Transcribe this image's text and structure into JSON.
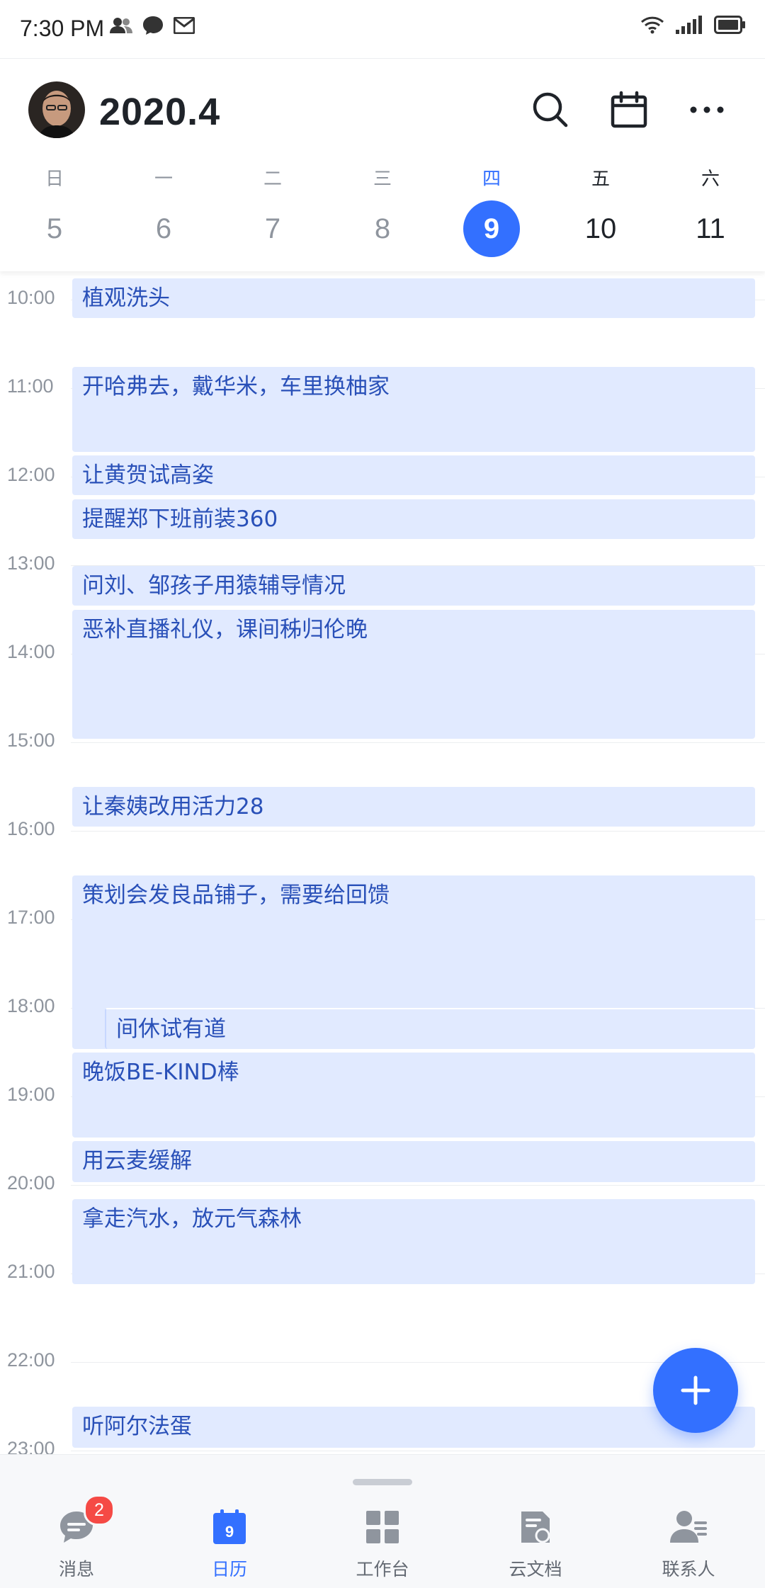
{
  "status_bar": {
    "time": "7:30 PM"
  },
  "header": {
    "title": "2020.4"
  },
  "week": {
    "days": [
      {
        "weekday": "日",
        "date": "5",
        "state": "past"
      },
      {
        "weekday": "一",
        "date": "6",
        "state": "past"
      },
      {
        "weekday": "二",
        "date": "7",
        "state": "past"
      },
      {
        "weekday": "三",
        "date": "8",
        "state": "past"
      },
      {
        "weekday": "四",
        "date": "9",
        "state": "selected"
      },
      {
        "weekday": "五",
        "date": "10",
        "state": "future"
      },
      {
        "weekday": "六",
        "date": "11",
        "state": "future"
      }
    ]
  },
  "hours": [
    "10:00",
    "11:00",
    "12:00",
    "13:00",
    "14:00",
    "15:00",
    "16:00",
    "17:00",
    "18:00",
    "19:00",
    "20:00",
    "21:00",
    "22:00",
    "23:00"
  ],
  "events": [
    {
      "title": "植观洗头"
    },
    {
      "title": "开哈弗去，戴华米，车里换柚家"
    },
    {
      "title": "让黄贺试高姿"
    },
    {
      "title": "提醒郑下班前装360"
    },
    {
      "title": "问刘、邹孩子用猿辅导情况"
    },
    {
      "title": "恶补直播礼仪，课间秭归伦晚"
    },
    {
      "title": "让秦姨改用活力28"
    },
    {
      "title": "策划会发良品铺子，需要给回馈"
    },
    {
      "title": "间休试有道"
    },
    {
      "title": "晚饭BE-KIND棒"
    },
    {
      "title": "用云麦缓解"
    },
    {
      "title": "拿走汽水，放元气森林"
    },
    {
      "title": "听阿尔法蛋"
    }
  ],
  "bottom_nav": {
    "items": [
      {
        "label": "消息",
        "badge": "2",
        "active": false
      },
      {
        "label": "日历",
        "active": true
      },
      {
        "label": "工作台",
        "active": false
      },
      {
        "label": "云文档",
        "active": false
      },
      {
        "label": "联系人",
        "active": false
      }
    ]
  },
  "colors": {
    "accent": "#3370ff",
    "event_bg": "#e1eaff",
    "event_text": "#2950b8",
    "badge": "#f54a45"
  }
}
